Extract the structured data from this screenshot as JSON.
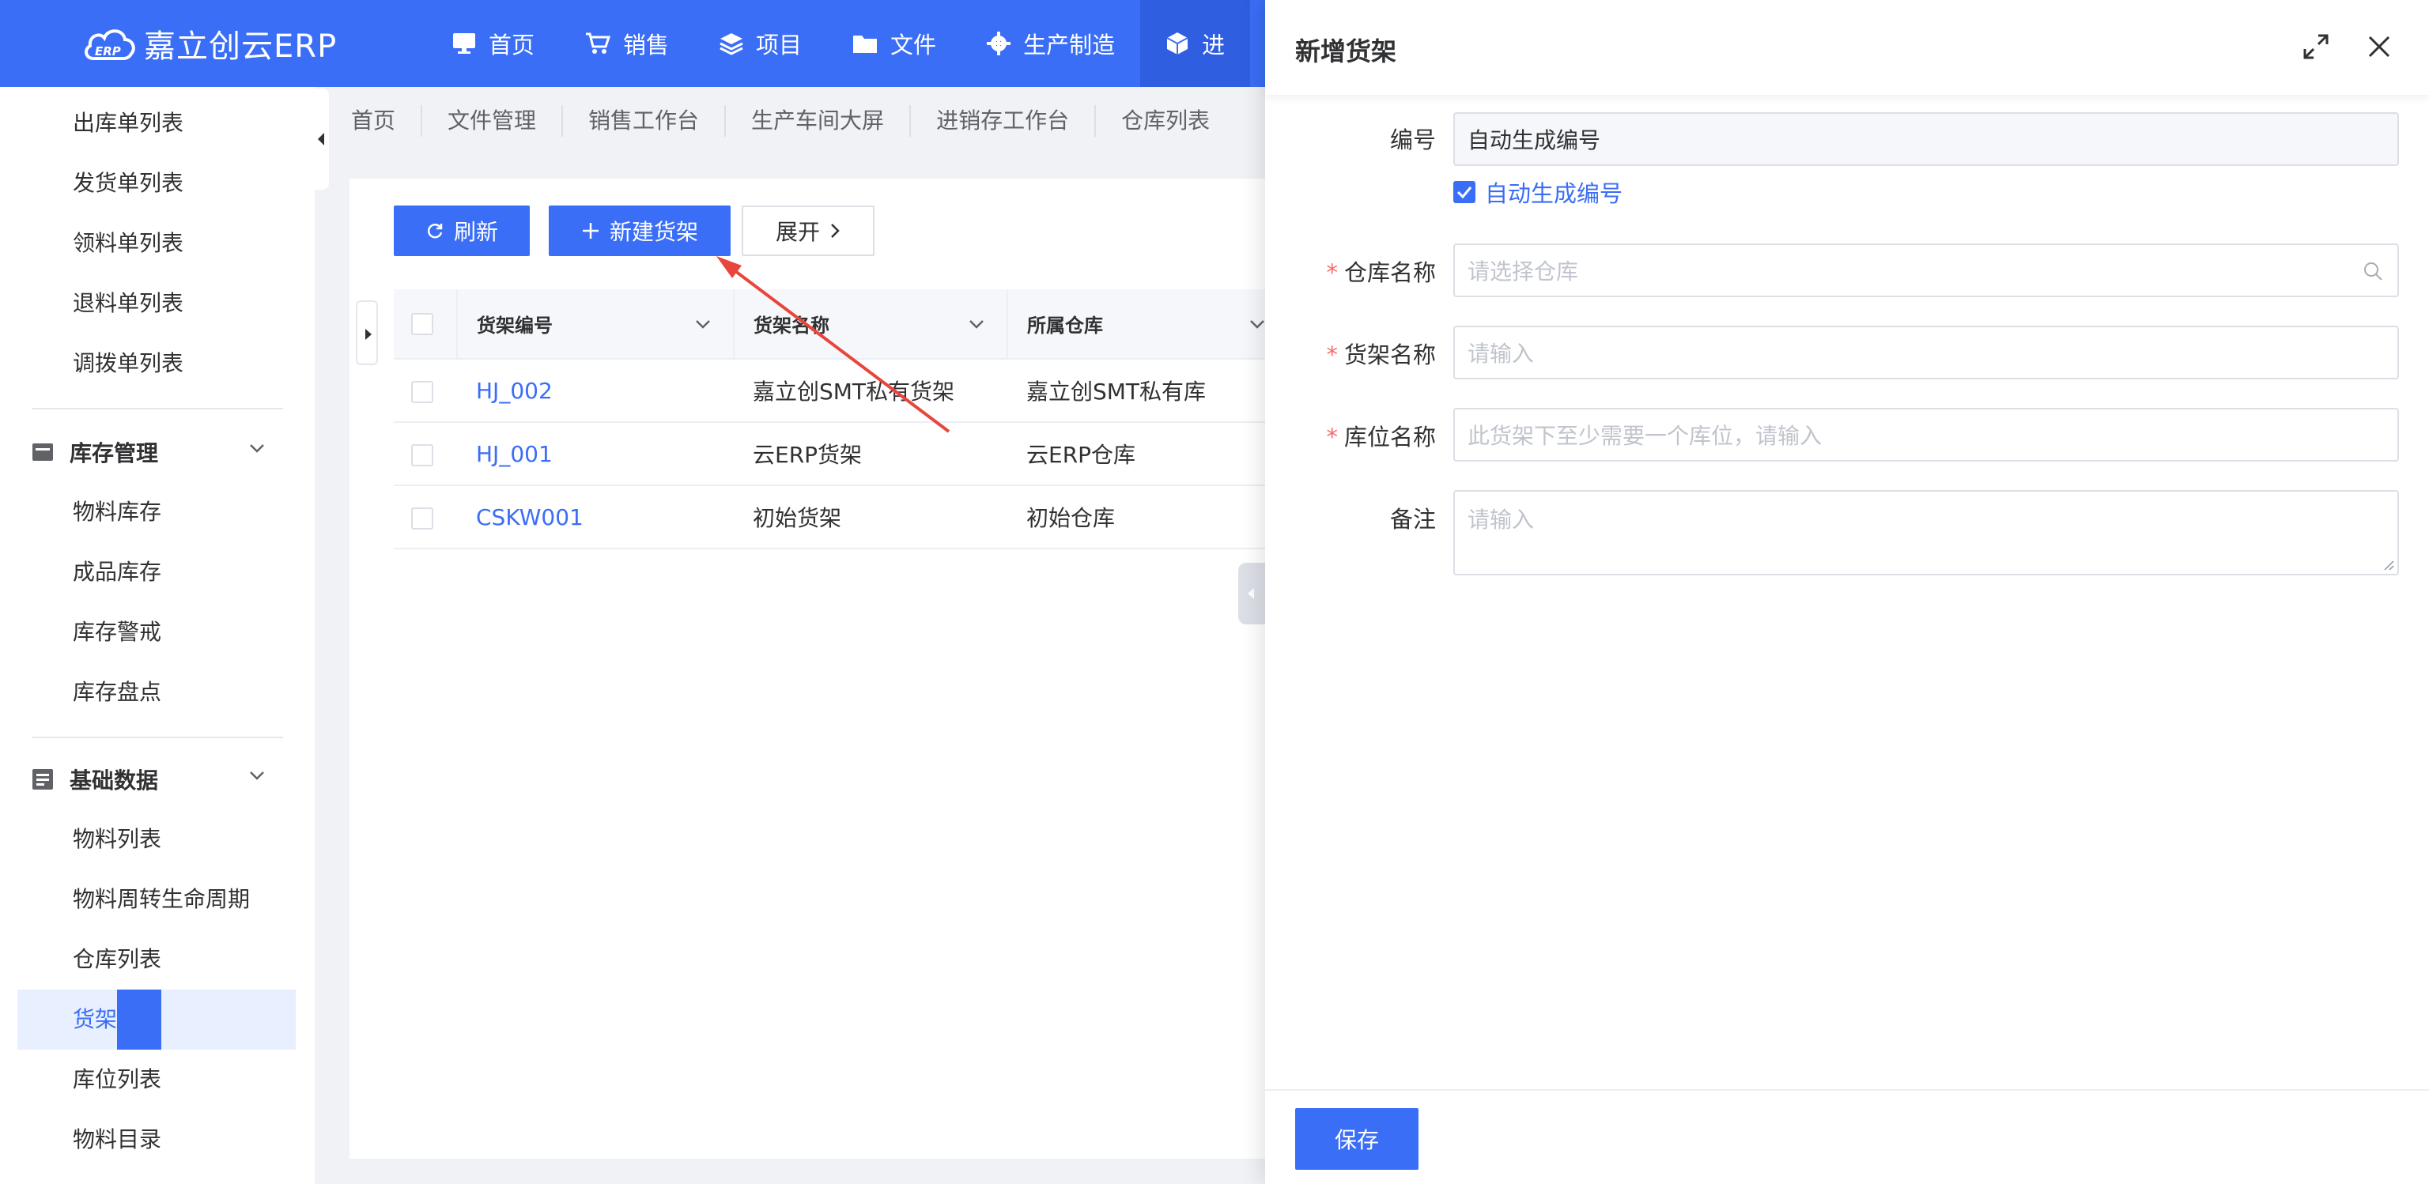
{
  "brand": {
    "name": "嘉立创云ERP",
    "logo_mark": "ERP"
  },
  "nav": [
    {
      "label": "首页",
      "icon": "monitor-icon"
    },
    {
      "label": "销售",
      "icon": "cart-icon"
    },
    {
      "label": "项目",
      "icon": "layers-icon"
    },
    {
      "label": "文件",
      "icon": "folder-icon"
    },
    {
      "label": "生产制造",
      "icon": "gear-icon"
    },
    {
      "label": "进",
      "icon": "cube-icon"
    }
  ],
  "sidebar": {
    "top_items": [
      "出库单列表",
      "发货单列表",
      "领料单列表",
      "退料单列表",
      "调拨单列表"
    ],
    "group_inventory": {
      "title": "库存管理",
      "items": [
        "物料库存",
        "成品库存",
        "库存警戒",
        "库存盘点"
      ]
    },
    "group_basic": {
      "title": "基础数据",
      "items": [
        "物料列表",
        "物料周转生命周期",
        "仓库列表",
        "货架列表",
        "库位列表",
        "物料目录"
      ]
    },
    "active_item": "货架列表"
  },
  "tabs": [
    "首页",
    "文件管理",
    "销售工作台",
    "生产车间大屏",
    "进销存工作台",
    "仓库列表"
  ],
  "toolbar": {
    "refresh": "刷新",
    "new_shelf": "新建货架",
    "expand": "展开"
  },
  "table": {
    "headers": {
      "code": "货架编号",
      "name": "货架名称",
      "warehouse": "所属仓库"
    },
    "rows": [
      {
        "code": "HJ_002",
        "name": "嘉立创SMT私有货架",
        "warehouse": "嘉立创SMT私有库"
      },
      {
        "code": "HJ_001",
        "name": "云ERP货架",
        "warehouse": "云ERP仓库"
      },
      {
        "code": "CSKW001",
        "name": "初始货架",
        "warehouse": "初始仓库"
      }
    ]
  },
  "drawer": {
    "title": "新增货架",
    "fields": {
      "code": {
        "label": "编号",
        "value": "自动生成编号"
      },
      "auto_code": {
        "label": "自动生成编号",
        "checked": true
      },
      "warehouse": {
        "label": "仓库名称",
        "placeholder": "请选择仓库"
      },
      "shelf": {
        "label": "货架名称",
        "placeholder": "请输入"
      },
      "location": {
        "label": "库位名称",
        "placeholder": "此货架下至少需要一个库位，请输入"
      },
      "remark": {
        "label": "备注",
        "placeholder": "请输入"
      }
    },
    "save": "保存"
  },
  "colors": {
    "primary": "#3b6ef6",
    "required": "#f56c6c",
    "annotation_arrow": "#e8453c"
  }
}
